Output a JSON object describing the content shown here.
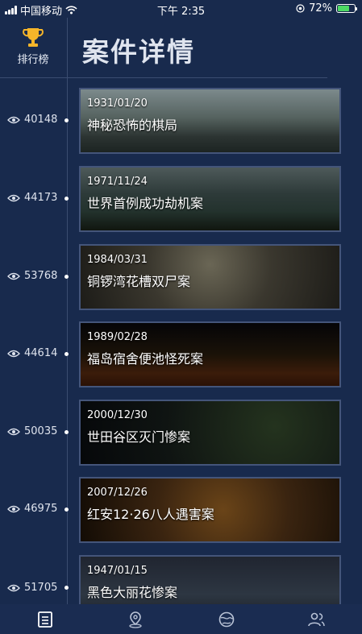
{
  "status_bar": {
    "carrier": "中国移动",
    "time": "下午 2:35",
    "battery": "72%"
  },
  "header": {
    "ranking_label": "排行榜",
    "title": "案件详情"
  },
  "cases": [
    {
      "date": "1931/01/20",
      "name": "神秘恐怖的棋局",
      "views": "40148"
    },
    {
      "date": "1971/11/24",
      "name": "世界首例成功劫机案",
      "views": "44173"
    },
    {
      "date": "1984/03/31",
      "name": "铜锣湾花槽双尸案",
      "views": "53768"
    },
    {
      "date": "1989/02/28",
      "name": "福岛宿舍便池怪死案",
      "views": "44614"
    },
    {
      "date": "2000/12/30",
      "name": "世田谷区灭门惨案",
      "views": "50035"
    },
    {
      "date": "2007/12/26",
      "name": "红安12·26八人遇害案",
      "views": "46975"
    },
    {
      "date": "1947/01/15",
      "name": "黑色大丽花惨案",
      "views": "51705"
    }
  ],
  "tabs": [
    {
      "icon": "document-icon",
      "active": true
    },
    {
      "icon": "map-pin-icon",
      "active": false
    },
    {
      "icon": "globe-icon",
      "active": false
    },
    {
      "icon": "people-icon",
      "active": false
    }
  ],
  "colors": {
    "background": "#182a4d",
    "tabbar": "#1a2c51",
    "divider": "#3a4c70",
    "battery": "#4cd964"
  }
}
